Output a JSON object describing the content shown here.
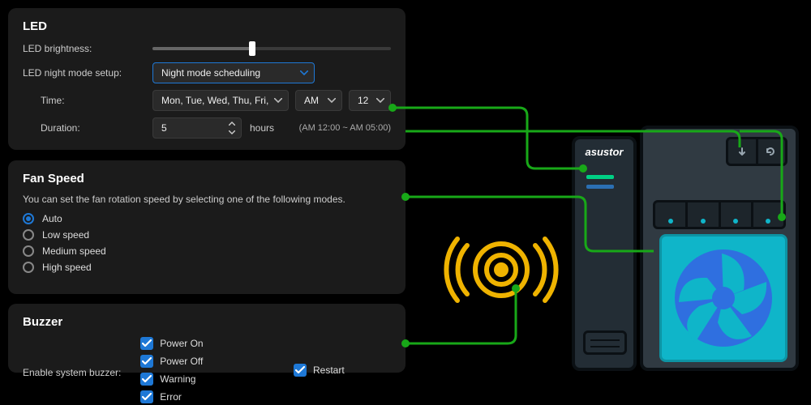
{
  "led": {
    "title": "LED",
    "brightness_label": "LED brightness:",
    "brightness_pct": 42,
    "night_mode_label": "LED night mode setup:",
    "night_mode_value": "Night mode scheduling",
    "time_label": "Time:",
    "days_value": "Mon, Tue, Wed, Thu, Fri, Sat, Sun",
    "ampm_value": "AM",
    "hour_value": "12",
    "duration_label": "Duration:",
    "duration_value": "5",
    "duration_unit": "hours",
    "duration_range": "(AM 12:00 ~ AM 05:00)"
  },
  "fan": {
    "title": "Fan Speed",
    "desc": "You can set the fan rotation speed by selecting one of the following modes.",
    "options": [
      "Auto",
      "Low speed",
      "Medium speed",
      "High speed"
    ],
    "selected": "Auto"
  },
  "buzzer": {
    "title": "Buzzer",
    "enable_label": "Enable system buzzer:",
    "items": [
      {
        "label": "Power On",
        "checked": true
      },
      {
        "label": "Power Off",
        "checked": true
      },
      {
        "label": "Restart",
        "checked": true
      },
      {
        "label": "Warning",
        "checked": true
      },
      {
        "label": "Error",
        "checked": true
      }
    ]
  },
  "device": {
    "brand": "asustor"
  },
  "colors": {
    "accent": "#1e78d6",
    "connector": "#18a818",
    "buzzer_icon": "#efb300",
    "fan_box": "#0fb5c9",
    "fan_blade": "#2f6fe0"
  }
}
